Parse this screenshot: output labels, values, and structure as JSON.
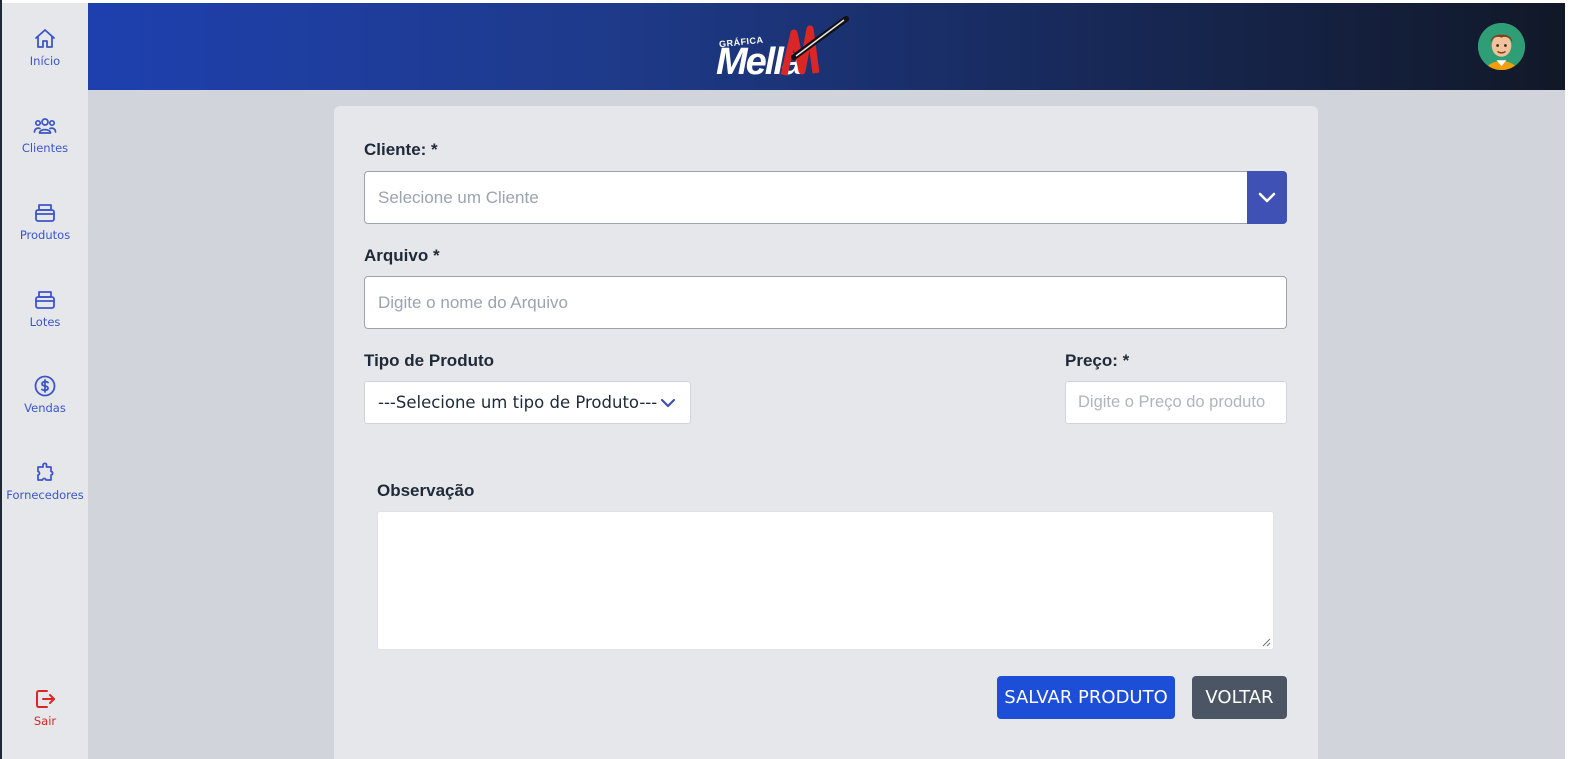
{
  "sidebar": {
    "items": [
      {
        "label": "Início",
        "icon": "home-icon"
      },
      {
        "label": "Clientes",
        "icon": "users-icon"
      },
      {
        "label": "Produtos",
        "icon": "box-icon"
      },
      {
        "label": "Lotes",
        "icon": "box-icon"
      },
      {
        "label": "Vendas",
        "icon": "dollar-circle-icon"
      },
      {
        "label": "Fornecedores",
        "icon": "puzzle-icon"
      }
    ],
    "exit": {
      "label": "Sair",
      "icon": "logout-icon"
    }
  },
  "header": {
    "logo_small": "GRÁFICA",
    "logo_big": "Mella",
    "avatar": "user-avatar"
  },
  "form": {
    "cliente_label": "Cliente: *",
    "cliente_placeholder": "Selecione um Cliente",
    "arquivo_label": "Arquivo *",
    "arquivo_placeholder": "Digite o nome do Arquivo",
    "tipo_label": "Tipo de Produto",
    "tipo_selected": "---Selecione um tipo de Produto---",
    "preco_label": "Preço: *",
    "preco_placeholder": "Digite o Preço do produto",
    "obs_label": "Observação",
    "obs_value": ""
  },
  "buttons": {
    "save": "SALVAR PRODUTO",
    "back": "VOLTAR"
  },
  "colors": {
    "accent": "#3f51b5",
    "primary_button": "#1d4ed8",
    "secondary_button": "#4b5563",
    "sidebar_icon": "#3b55c8",
    "exit": "#dc2626"
  }
}
